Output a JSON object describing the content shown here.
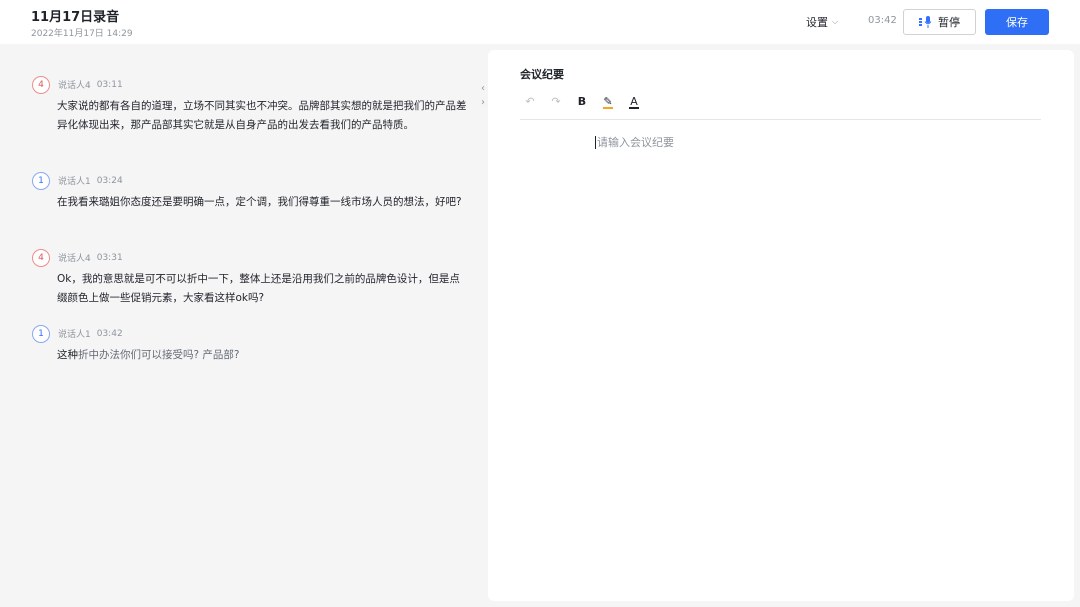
{
  "header": {
    "title": "11月17日录音",
    "subtitle": "2022年11月17日 14:29",
    "settings_label": "设置",
    "timer": "03:42",
    "pause_label": "暂停",
    "save_label": "保存",
    "accent_color": "#2f6ff6"
  },
  "transcript": [
    {
      "avatar": "4",
      "speaker": "说话人4",
      "time": "03:11",
      "text": "大家说的都有各自的道理，立场不同其实也不冲突。品牌部其实想的就是把我们的产品差异化体现出来，那产品部其实它就是从自身产品的出发去看我们的产品特质。",
      "text_faded": ""
    },
    {
      "avatar": "1",
      "speaker": "说话人1",
      "time": "03:24",
      "text": "在我看来璐姐你态度还是要明确一点，定个调，我们得尊重一线市场人员的想法，好吧?",
      "text_faded": ""
    },
    {
      "avatar": "4",
      "speaker": "说话人4",
      "time": "03:31",
      "text": " Ok，我的意思就是可不可以折中一下，整体上还是沿用我们之前的品牌色设计，但是点缀颜色上做一些促销元素，大家看这样ok吗?",
      "text_faded": ""
    },
    {
      "avatar": "1",
      "speaker": "说话人1",
      "time": "03:42",
      "text": "这种",
      "text_faded": "折中办法你们可以接受吗? 产品部?"
    }
  ],
  "collapse": {
    "left": "‹",
    "right": "›"
  },
  "notes": {
    "title": "会议纪要",
    "placeholder": "请输入会议纪要",
    "toolbar": {
      "undo": "↶",
      "redo": "↷",
      "bold": "B",
      "highlight": "✎",
      "font_color": "A"
    }
  }
}
